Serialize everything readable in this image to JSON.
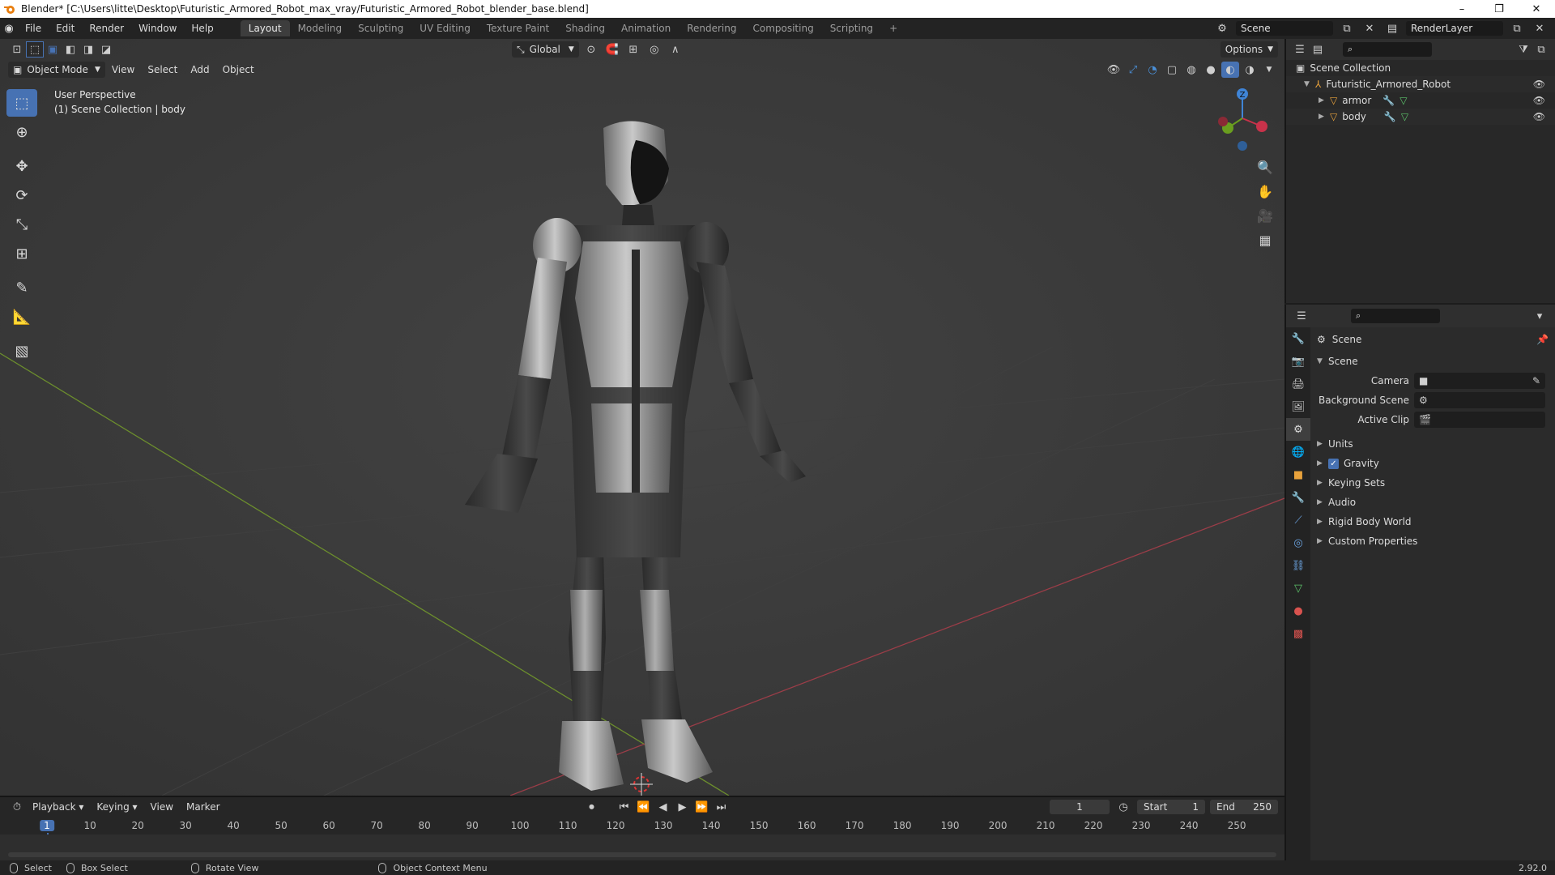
{
  "titlebar": {
    "title": "Blender* [C:\\Users\\litte\\Desktop\\Futuristic_Armored_Robot_max_vray/Futuristic_Armored_Robot_blender_base.blend]",
    "minimize": "–",
    "maximize": "❐",
    "close": "✕"
  },
  "menu": [
    "File",
    "Edit",
    "Render",
    "Window",
    "Help"
  ],
  "workspaces": [
    "Layout",
    "Modeling",
    "Sculpting",
    "UV Editing",
    "Texture Paint",
    "Shading",
    "Animation",
    "Rendering",
    "Compositing",
    "Scripting"
  ],
  "active_workspace": "Layout",
  "scene_name": "Scene",
  "render_layer": "RenderLayer",
  "viewport": {
    "mode": "Object Mode",
    "menus": [
      "View",
      "Select",
      "Add",
      "Object"
    ],
    "transform_orientation": "Global",
    "options": "Options",
    "perspective": "User Perspective",
    "collection_info": "(1) Scene Collection | body",
    "gizmo_axes": {
      "x": "X",
      "y": "Y",
      "z": "Z"
    }
  },
  "outliner": {
    "root": "Scene Collection",
    "items": [
      {
        "label": "Futuristic_Armored_Robot",
        "level": 1
      },
      {
        "label": "armor",
        "level": 2
      },
      {
        "label": "body",
        "level": 2
      }
    ]
  },
  "properties": {
    "context": "Scene",
    "section": "Scene",
    "fields": [
      {
        "label": "Camera",
        "value": ""
      },
      {
        "label": "Background Scene",
        "value": ""
      },
      {
        "label": "Active Clip",
        "value": ""
      }
    ],
    "panels": [
      "Units",
      "Gravity",
      "Keying Sets",
      "Audio",
      "Rigid Body World",
      "Custom Properties"
    ],
    "gravity_checked": true
  },
  "timeline": {
    "menus": [
      "Playback",
      "Keying",
      "View",
      "Marker"
    ],
    "current_frame": "1",
    "start_label": "Start",
    "start": "1",
    "end_label": "End",
    "end": "250",
    "ticks": [
      "1",
      "10",
      "20",
      "30",
      "40",
      "50",
      "60",
      "70",
      "80",
      "90",
      "100",
      "110",
      "120",
      "130",
      "140",
      "150",
      "160",
      "170",
      "180",
      "190",
      "200",
      "210",
      "220",
      "230",
      "240",
      "250"
    ]
  },
  "statusbar": {
    "select": "Select",
    "box_select": "Box Select",
    "rotate_view": "Rotate View",
    "context_menu": "Object Context Menu",
    "version": "2.92.0"
  }
}
